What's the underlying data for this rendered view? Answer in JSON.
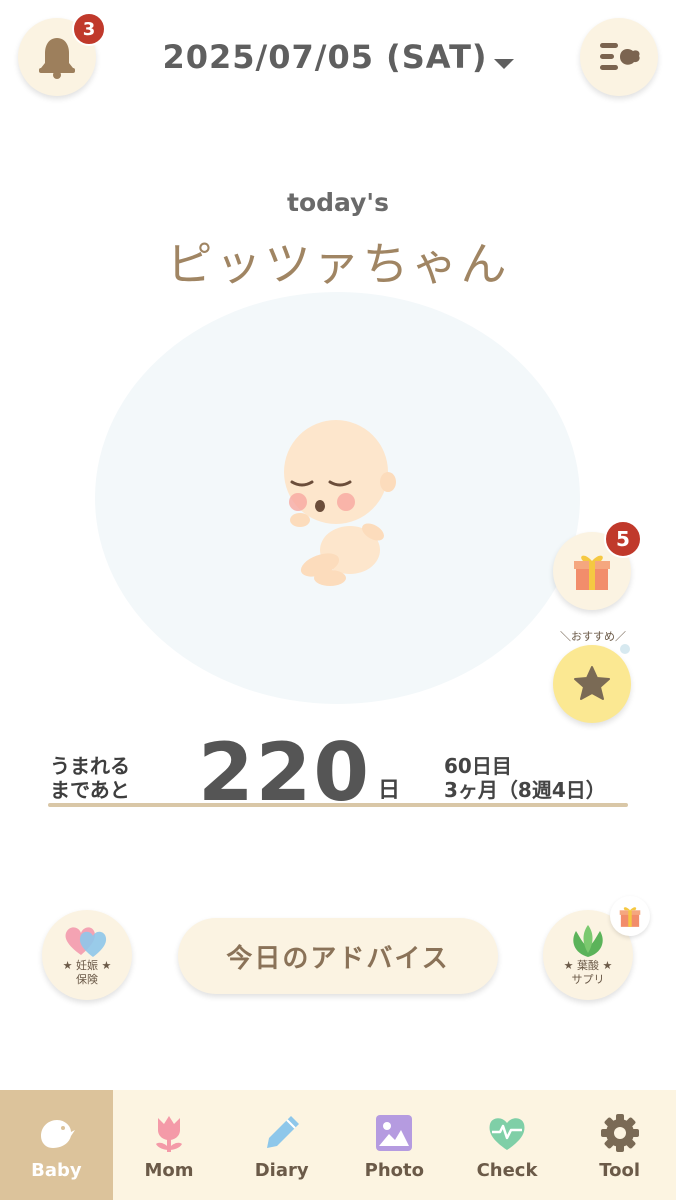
{
  "header": {
    "notification_count": "3",
    "date": "2025/07/05 (SAT)"
  },
  "main": {
    "todays_label": "today's",
    "baby_name": "ピッツァちゃん",
    "gift_count": "5",
    "recommend_label": "＼おすすめ／"
  },
  "countdown": {
    "label_line1": "うまれる",
    "label_line2": "まであと",
    "days_left": "220",
    "unit": "日",
    "day_count": "60日目",
    "month_week": "3ヶ月（8週4日）"
  },
  "actions": {
    "insurance_line1": "★ 妊娠 ★",
    "insurance_line2": "保険",
    "advice_label": "今日のアドバイス",
    "supplement_line1": "★ 葉酸 ★",
    "supplement_line2": "サプリ"
  },
  "tabs": [
    {
      "label": "Baby",
      "icon": "bird-icon",
      "active": true
    },
    {
      "label": "Mom",
      "icon": "tulip-icon",
      "active": false
    },
    {
      "label": "Diary",
      "icon": "pen-icon",
      "active": false
    },
    {
      "label": "Photo",
      "icon": "photo-icon",
      "active": false
    },
    {
      "label": "Check",
      "icon": "heart-pulse-icon",
      "active": false
    },
    {
      "label": "Tool",
      "icon": "gear-icon",
      "active": false
    }
  ],
  "colors": {
    "accent": "#dcc39b",
    "badge": "#c0392b",
    "button_bg": "#fbf3e2",
    "star_button": "#fbe892",
    "tabbar_bg": "#fcf4e1"
  }
}
